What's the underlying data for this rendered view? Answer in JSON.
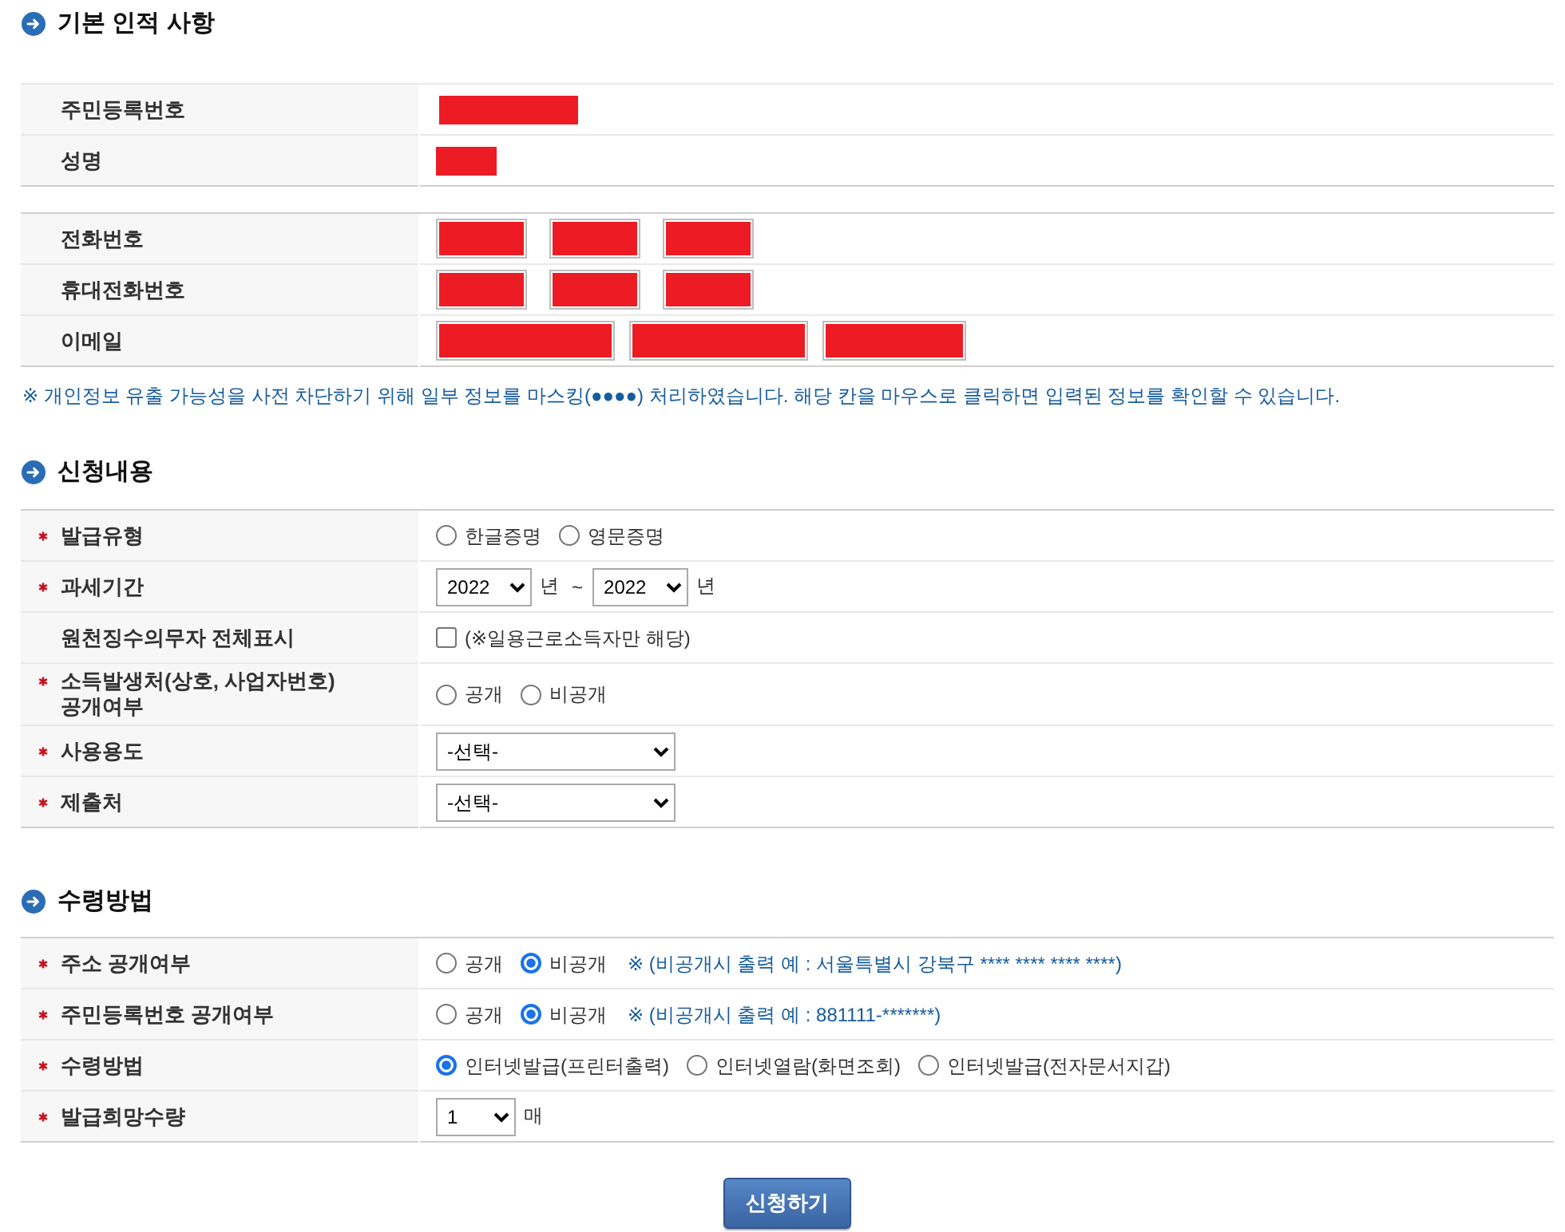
{
  "sections": [
    {
      "title": "기본 인적 사항",
      "tables": [
        {
          "rows": [
            {
              "label": "주민등록번호",
              "required": false,
              "kind": "id",
              "redacted": true
            },
            {
              "label": "성명",
              "required": false,
              "kind": "name",
              "redacted": true
            }
          ]
        },
        {
          "rows": [
            {
              "label": "전화번호",
              "required": false,
              "kind": "phone",
              "redacted": true
            },
            {
              "label": "휴대전화번호",
              "required": false,
              "kind": "phone",
              "redacted": true
            },
            {
              "label": "이메일",
              "required": false,
              "kind": "email",
              "redacted": true
            }
          ]
        }
      ],
      "note": "※ 개인정보 유출 가능성을 사전 차단하기 위해 일부 정보를 마스킹(●●●●) 처리하였습니다. 해당 칸을 마우스로 클릭하면 입력된 정보를 확인할 수 있습니다."
    },
    {
      "title": "신청내용",
      "tables": [
        {
          "rows": [
            {
              "label": "발급유형",
              "required": true,
              "kind": "radios",
              "options": [
                {
                  "label": "한글증명",
                  "selected": false
                },
                {
                  "label": "영문증명",
                  "selected": false
                }
              ]
            },
            {
              "label": "과세기간",
              "required": true,
              "kind": "period",
              "start": "2022",
              "start_unit": "년",
              "separator": "~",
              "end": "2022",
              "end_unit": "년"
            },
            {
              "label": "원천징수의무자 전체표시",
              "required": false,
              "kind": "checkbox",
              "checked": false,
              "text": "(※일용근로소득자만 해당)"
            },
            {
              "label": "소득발생처(상호, 사업자번호)\n공개여부",
              "required": true,
              "kind": "radios",
              "options": [
                {
                  "label": "공개",
                  "selected": false
                },
                {
                  "label": "비공개",
                  "selected": false
                }
              ]
            },
            {
              "label": "사용용도",
              "required": true,
              "kind": "select",
              "value": "-선택-"
            },
            {
              "label": "제출처",
              "required": true,
              "kind": "select",
              "value": "-선택-"
            }
          ]
        }
      ]
    },
    {
      "title": "수령방법",
      "tables": [
        {
          "rows": [
            {
              "label": "주소 공개여부",
              "required": true,
              "kind": "radios",
              "options": [
                {
                  "label": "공개",
                  "selected": false
                },
                {
                  "label": "비공개",
                  "selected": true
                }
              ],
              "note": "※ (비공개시 출력 예 : 서울특별시 강북구 **** **** **** ****)"
            },
            {
              "label": "주민등록번호 공개여부",
              "required": true,
              "kind": "radios",
              "options": [
                {
                  "label": "공개",
                  "selected": false
                },
                {
                  "label": "비공개",
                  "selected": true
                }
              ],
              "note": "※ (비공개시 출력 예 : 881111-*******)"
            },
            {
              "label": "수령방법",
              "required": true,
              "kind": "radios",
              "options": [
                {
                  "label": "인터넷발급(프린터출력)",
                  "selected": true
                },
                {
                  "label": "인터넷열람(화면조회)",
                  "selected": false
                },
                {
                  "label": "인터넷발급(전자문서지갑)",
                  "selected": false
                }
              ]
            },
            {
              "label": "발급희망수량",
              "required": true,
              "kind": "quantity",
              "value": "1",
              "unit": "매"
            }
          ]
        }
      ]
    }
  ],
  "submit_button": {
    "label": "신청하기"
  }
}
